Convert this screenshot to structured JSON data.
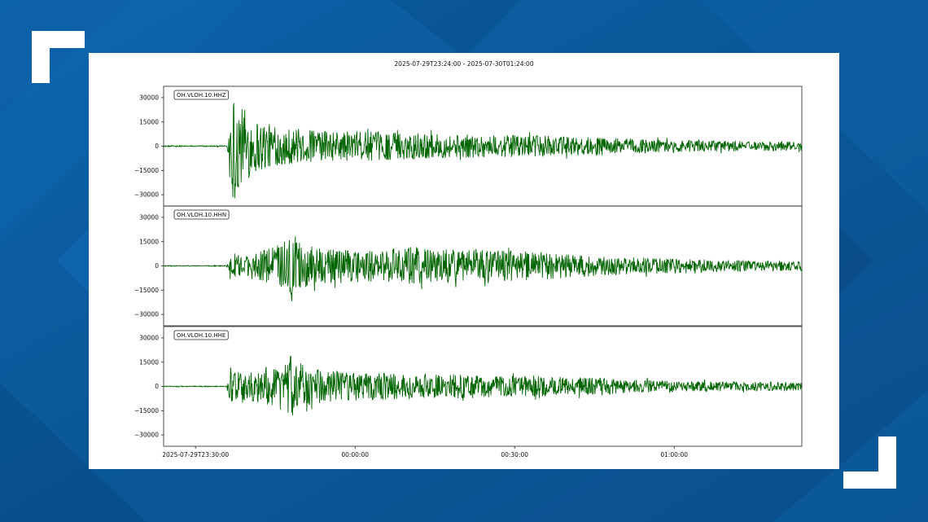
{
  "colors": {
    "background": "#0b5a9e",
    "panel": "#ffffff",
    "trace": "#006400",
    "corner_brackets": "#ffffff"
  },
  "icons": [
    "corner-bracket-top-left",
    "corner-bracket-bottom-right"
  ],
  "chart_data": {
    "type": "line",
    "title": "2025-07-29T23:24:00  -  2025-07-30T01:24:00",
    "x_range": [
      "2025-07-29T23:24:00",
      "2025-07-30T01:24:00"
    ],
    "x_ticks": [
      {
        "time": "2025-07-29T23:30:00",
        "label": "2025-07-29T23:30:00"
      },
      {
        "time": "2025-07-30T00:00:00",
        "label": "00:00:00"
      },
      {
        "time": "2025-07-30T00:30:00",
        "label": "00:30:00"
      },
      {
        "time": "2025-07-30T01:00:00",
        "label": "01:00:00"
      }
    ],
    "ylim": [
      -37000,
      37000
    ],
    "y_ticks": [
      30000,
      15000,
      0,
      -15000,
      -30000
    ],
    "y_tick_labels": [
      "30000",
      "15000",
      "0",
      "−15000",
      "−30000"
    ],
    "grid": false,
    "panels": [
      {
        "name": "OH.VLOH.10.HHZ",
        "onset": "2025-07-29T23:36:00",
        "envelope": [
          {
            "t": "2025-07-29T23:24:00",
            "amp": 400
          },
          {
            "t": "2025-07-29T23:35:50",
            "amp": 400
          },
          {
            "t": "2025-07-29T23:36:30",
            "amp": 30000
          },
          {
            "t": "2025-07-29T23:37:30",
            "amp": 33000
          },
          {
            "t": "2025-07-29T23:40:00",
            "amp": 20000
          },
          {
            "t": "2025-07-29T23:45:00",
            "amp": 12000
          },
          {
            "t": "2025-07-29T23:55:00",
            "amp": 9500
          },
          {
            "t": "2025-07-30T00:05:00",
            "amp": 9000
          },
          {
            "t": "2025-07-30T00:15:00",
            "amp": 7500
          },
          {
            "t": "2025-07-30T00:25:00",
            "amp": 7000
          },
          {
            "t": "2025-07-30T00:35:00",
            "amp": 6500
          },
          {
            "t": "2025-07-30T00:45:00",
            "amp": 5500
          },
          {
            "t": "2025-07-30T00:55:00",
            "amp": 4500
          },
          {
            "t": "2025-07-30T01:05:00",
            "amp": 3500
          },
          {
            "t": "2025-07-30T01:15:00",
            "amp": 3000
          },
          {
            "t": "2025-07-30T01:24:00",
            "amp": 2800
          }
        ]
      },
      {
        "name": "OH.VLOH.10.HHN",
        "onset": "2025-07-29T23:36:00",
        "envelope": [
          {
            "t": "2025-07-29T23:24:00",
            "amp": 300
          },
          {
            "t": "2025-07-29T23:35:50",
            "amp": 300
          },
          {
            "t": "2025-07-29T23:36:30",
            "amp": 7000
          },
          {
            "t": "2025-07-29T23:40:00",
            "amp": 6500
          },
          {
            "t": "2025-07-29T23:45:00",
            "amp": 12000
          },
          {
            "t": "2025-07-29T23:48:00",
            "amp": 18000
          },
          {
            "t": "2025-07-29T23:52:00",
            "amp": 12000
          },
          {
            "t": "2025-07-30T00:00:00",
            "amp": 10000
          },
          {
            "t": "2025-07-30T00:10:00",
            "amp": 12000
          },
          {
            "t": "2025-07-30T00:20:00",
            "amp": 10000
          },
          {
            "t": "2025-07-30T00:30:00",
            "amp": 9500
          },
          {
            "t": "2025-07-30T00:40:00",
            "amp": 7500
          },
          {
            "t": "2025-07-30T00:50:00",
            "amp": 5500
          },
          {
            "t": "2025-07-30T01:00:00",
            "amp": 4500
          },
          {
            "t": "2025-07-30T01:10:00",
            "amp": 3500
          },
          {
            "t": "2025-07-30T01:24:00",
            "amp": 3000
          }
        ]
      },
      {
        "name": "OH.VLOH.10.HHE",
        "onset": "2025-07-29T23:36:00",
        "envelope": [
          {
            "t": "2025-07-29T23:24:00",
            "amp": 300
          },
          {
            "t": "2025-07-29T23:35:50",
            "amp": 300
          },
          {
            "t": "2025-07-29T23:36:30",
            "amp": 12000
          },
          {
            "t": "2025-07-29T23:40:00",
            "amp": 9000
          },
          {
            "t": "2025-07-29T23:45:00",
            "amp": 14000
          },
          {
            "t": "2025-07-29T23:48:00",
            "amp": 19000
          },
          {
            "t": "2025-07-29T23:52:00",
            "amp": 11000
          },
          {
            "t": "2025-07-30T00:00:00",
            "amp": 9000
          },
          {
            "t": "2025-07-30T00:10:00",
            "amp": 8000
          },
          {
            "t": "2025-07-30T00:20:00",
            "amp": 7500
          },
          {
            "t": "2025-07-30T00:30:00",
            "amp": 6500
          },
          {
            "t": "2025-07-30T00:40:00",
            "amp": 6000
          },
          {
            "t": "2025-07-30T00:50:00",
            "amp": 4500
          },
          {
            "t": "2025-07-30T01:00:00",
            "amp": 3500
          },
          {
            "t": "2025-07-30T01:10:00",
            "amp": 3000
          },
          {
            "t": "2025-07-30T01:24:00",
            "amp": 2500
          }
        ]
      }
    ]
  }
}
